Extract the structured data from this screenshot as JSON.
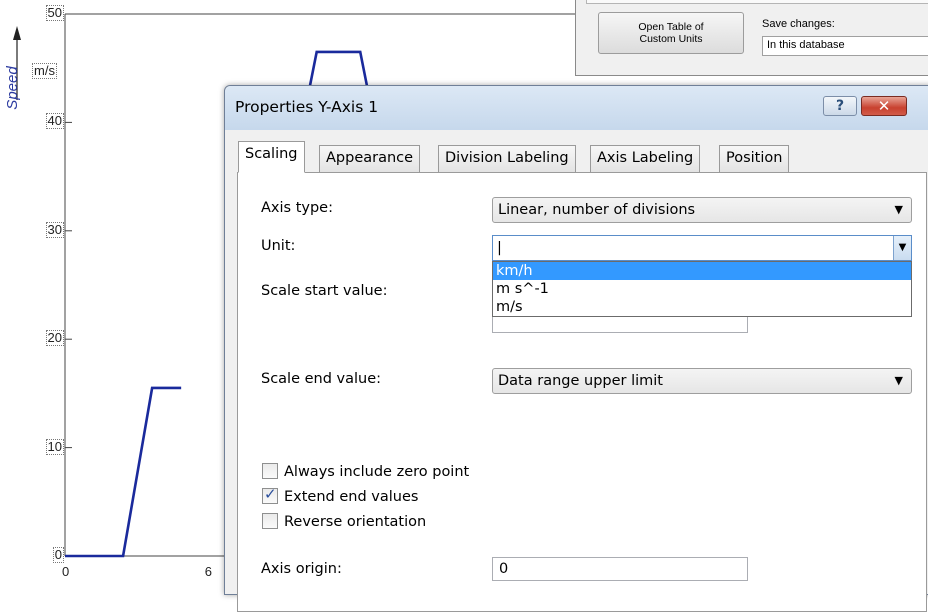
{
  "chart": {
    "ylabel": "Speed",
    "yunit": "m/s",
    "yticks": [
      "0",
      "10",
      "20",
      "30",
      "40",
      "50"
    ],
    "xticks": [
      "0",
      "6"
    ],
    "line_color": "#1a2a9c"
  },
  "chart_data": {
    "type": "line",
    "ylabel": "Speed",
    "ylim": [
      0,
      50
    ],
    "series": [
      {
        "x": [
          0,
          2.4,
          3.6,
          4.8
        ],
        "y": [
          0,
          0,
          15.5,
          15.5
        ]
      },
      {
        "x": [
          10.0,
          10.4,
          12.2,
          12.6
        ],
        "y": [
          42,
          46.5,
          46.5,
          42
        ]
      }
    ]
  },
  "background_window": {
    "open_table_label": "Open Table of Custom Units",
    "save_changes_label": "Save changes:",
    "save_changes_value": "In this database"
  },
  "dialog": {
    "title": "Properties Y-Axis 1",
    "help_button": "?",
    "close_button": "✕",
    "tabs": [
      "Scaling",
      "Appearance",
      "Division Labeling",
      "Axis Labeling",
      "Position"
    ],
    "axis_type_label": "Axis type:",
    "axis_type_value": "Linear, number of divisions",
    "unit_label": "Unit:",
    "unit_value": "|",
    "unit_options": [
      "km/h",
      "m s^-1",
      "m/s"
    ],
    "scale_start_label": "Scale start value:",
    "scale_end_label": "Scale end value:",
    "scale_end_value": "Data range upper limit",
    "always_zero_label": "Always include zero point",
    "extend_end_label": "Extend end values",
    "reverse_label": "Reverse orientation",
    "axis_origin_label": "Axis origin:",
    "axis_origin_value": "0"
  }
}
